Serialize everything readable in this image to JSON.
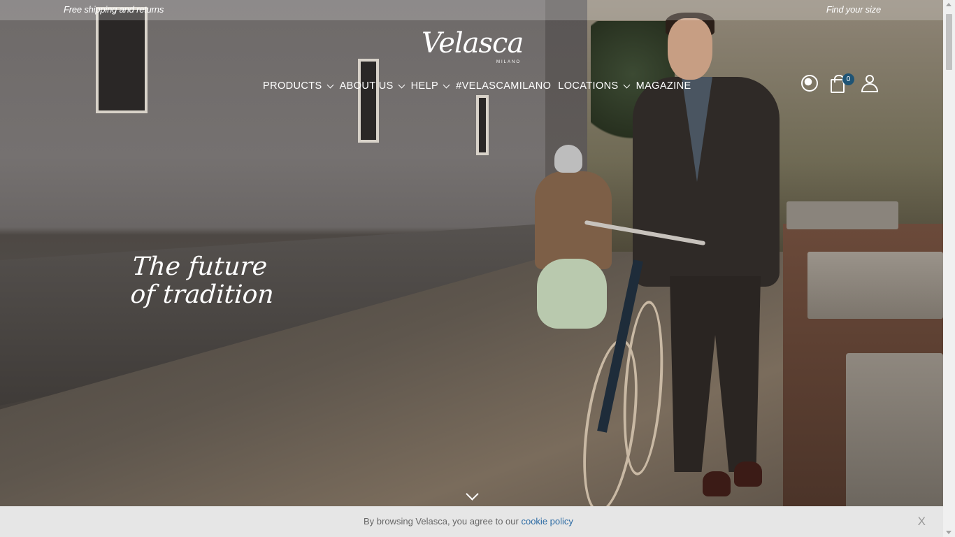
{
  "promo": {
    "left": "Free shipping and returns",
    "right": "Find your size"
  },
  "logo": {
    "name": "Velasca",
    "sub": "MILANO"
  },
  "nav": {
    "items": [
      {
        "label": "PRODUCTS",
        "dropdown": true
      },
      {
        "label": "ABOUT US",
        "dropdown": true
      },
      {
        "label": "HELP",
        "dropdown": true
      },
      {
        "label": "#VELASCAMILANO",
        "dropdown": false
      },
      {
        "label": "LOCATIONS",
        "dropdown": true
      },
      {
        "label": "MAGAZINE",
        "dropdown": false
      }
    ]
  },
  "header": {
    "icons": [
      "globe-icon",
      "shopping-bag-icon",
      "user-icon"
    ],
    "cart_count": "0"
  },
  "hero": {
    "tagline_line1": "The future",
    "tagline_line2": "of tradition"
  },
  "cookie": {
    "text": "By browsing Velasca, you agree to our ",
    "link": "cookie policy",
    "close": "X"
  },
  "colors": {
    "cart_badge": "#1f5475",
    "cookie_bar": "#e6e6e6",
    "cookie_link": "#2b6aa3"
  }
}
